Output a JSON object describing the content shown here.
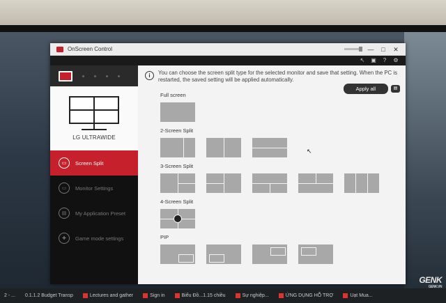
{
  "window": {
    "title": "OnScreen Control",
    "controls": {
      "minimize": "—",
      "restore": "□",
      "close": "✕"
    }
  },
  "toolbar": {
    "icons": [
      "pointer-icon",
      "monitor-icon",
      "help-icon",
      "gear-icon"
    ],
    "help": "?"
  },
  "sidebar": {
    "model": "LG ULTRAWIDE",
    "items": [
      {
        "label": "Screen Split",
        "icon": "screen-split-icon",
        "active": true
      },
      {
        "label": "Monitor Settings",
        "icon": "monitor-settings-icon",
        "active": false
      },
      {
        "label": "My Application Preset",
        "icon": "app-preset-icon",
        "active": false
      },
      {
        "label": "Game mode settings",
        "icon": "gamepad-icon",
        "active": false
      }
    ]
  },
  "main": {
    "info": "You can choose the screen split type for the selected monitor and save that setting. When the PC is restarted, the saved setting will be applied automatically.",
    "apply_label": "Apply all",
    "sections": [
      {
        "label": "Full screen",
        "count": 1
      },
      {
        "label": "2-Screen Split",
        "count": 3
      },
      {
        "label": "3-Screen Split",
        "count": 5
      },
      {
        "label": "4-Screen Split",
        "count": 1
      },
      {
        "label": "PIP",
        "count": 4
      }
    ]
  },
  "taskbar": {
    "items": [
      "2 - ...",
      "0.1.1.2 Budget Transp",
      "Lectures and gather",
      "Sign in",
      "Biểu Đồ...1.15 chiều",
      "Sự nghiệp...",
      "ỨNG DỤNG HỖ TRỢ",
      "Uạt Mua..."
    ]
  },
  "watermark": {
    "brand": "GENK",
    "sub": "GENK.VN"
  },
  "colors": {
    "accent": "#c5202c",
    "sidebar": "#111111",
    "tile": "#a8a8a8"
  }
}
